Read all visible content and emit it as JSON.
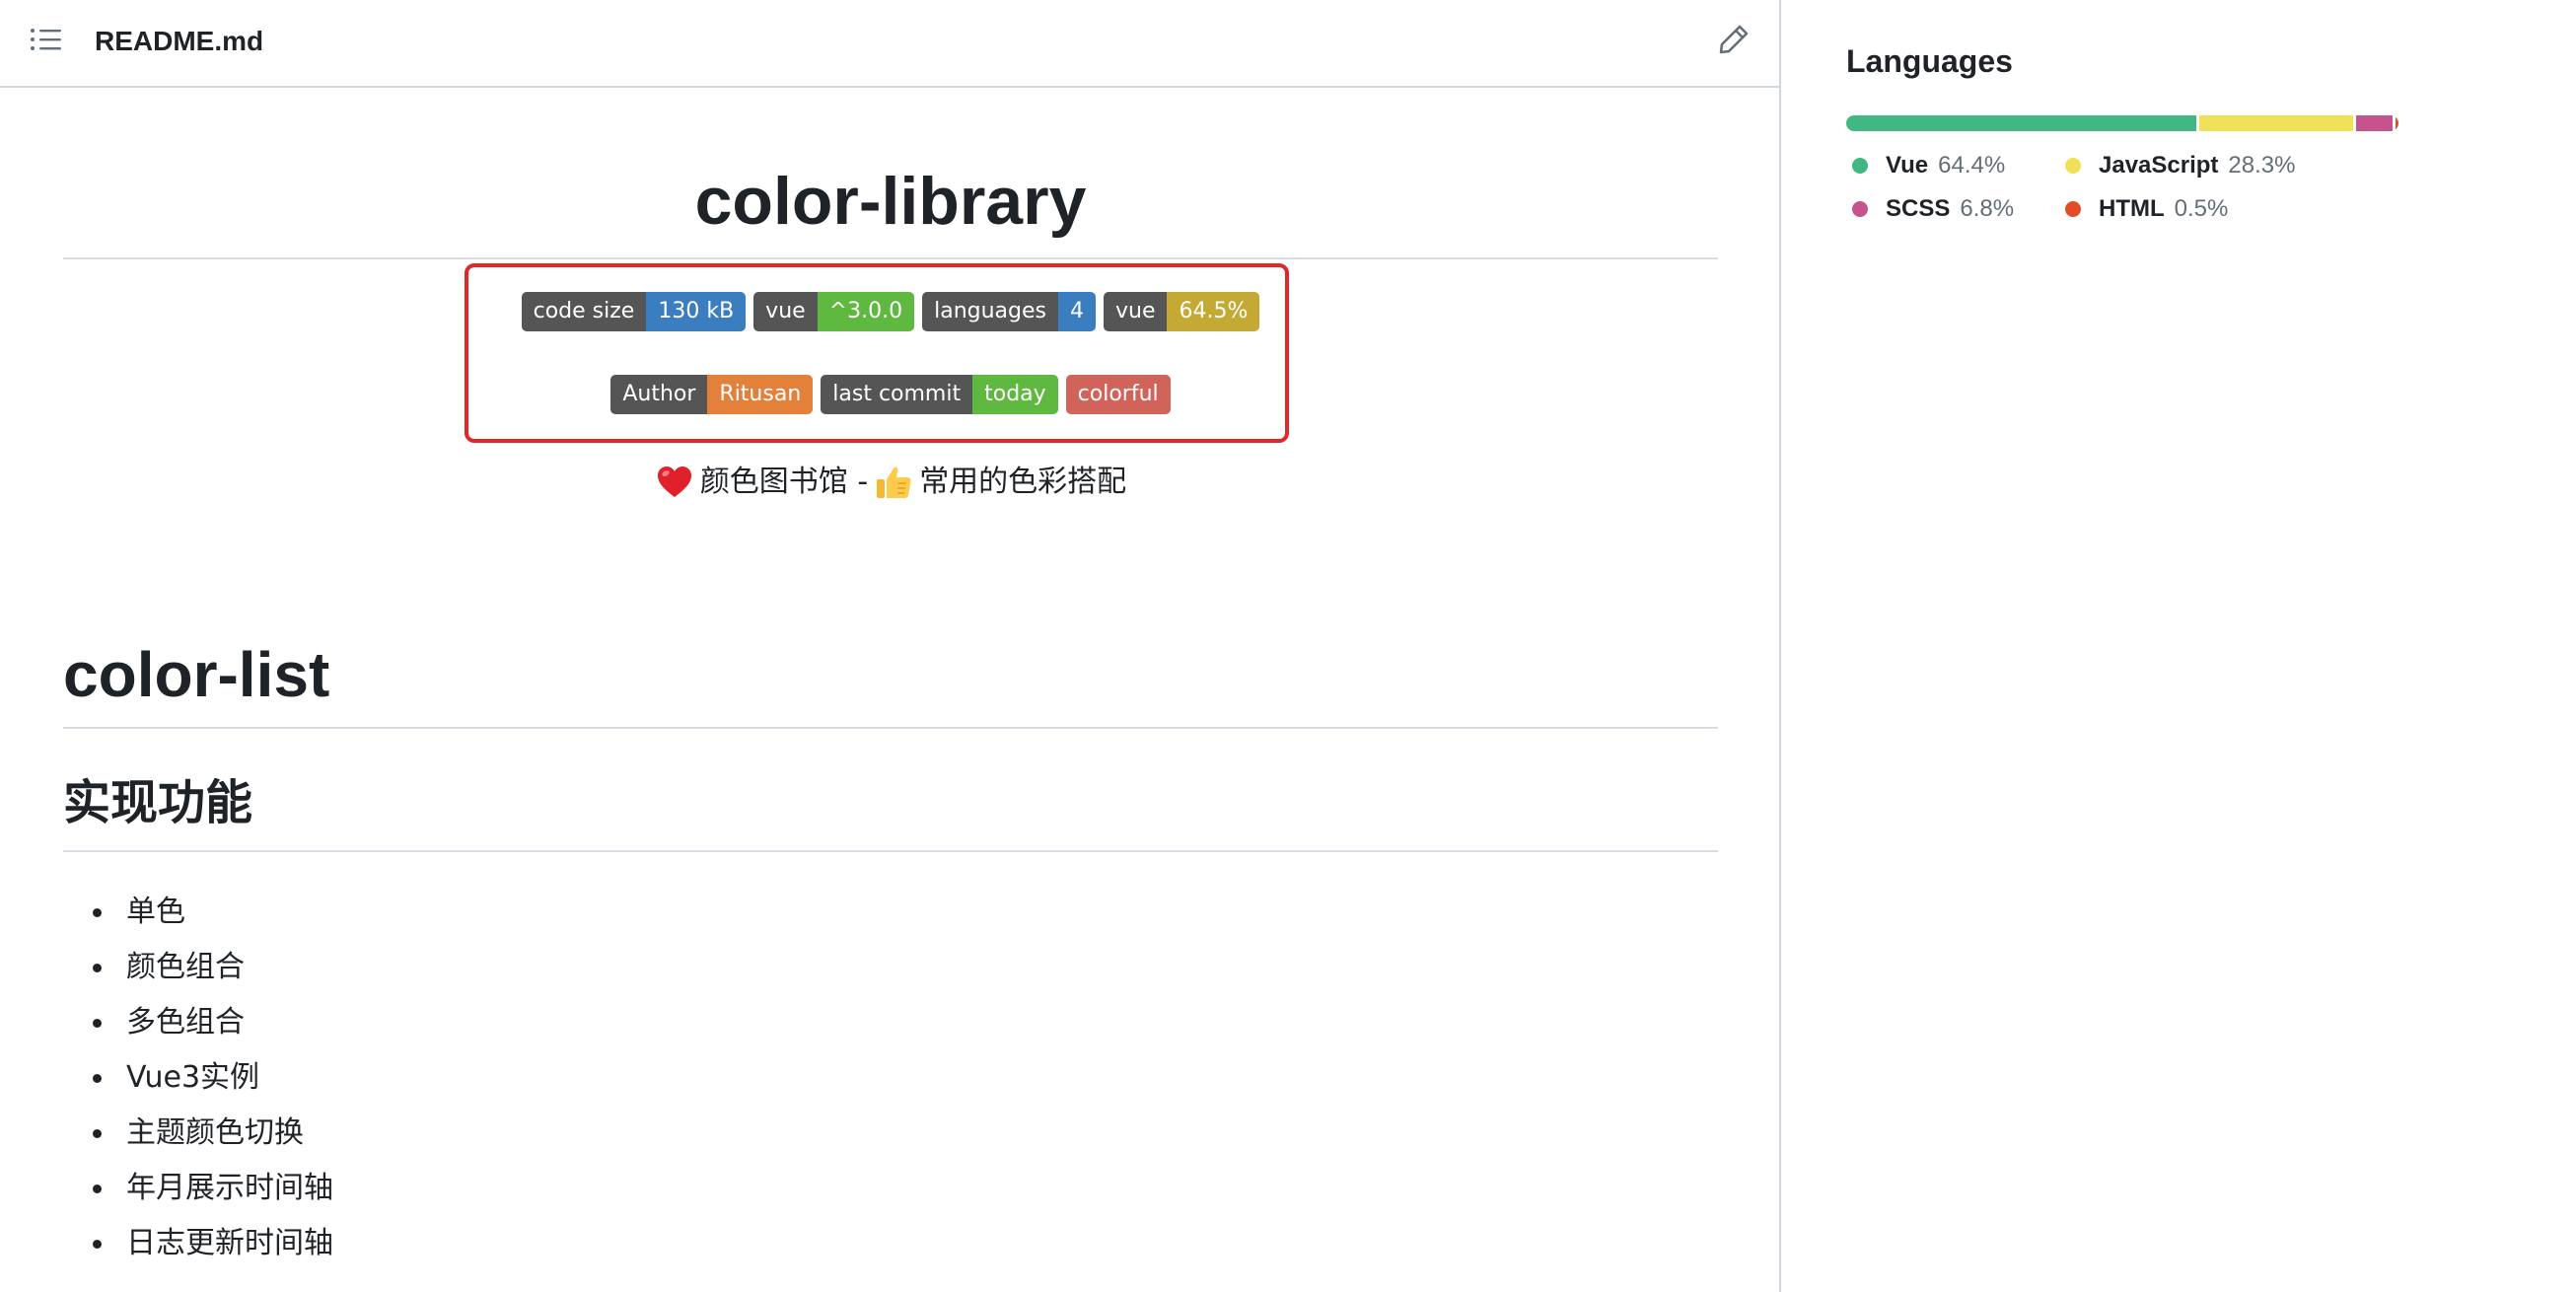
{
  "readme": {
    "filename": "README.md",
    "title": "color-library",
    "badges_row1": [
      {
        "label": "code size",
        "value": "130 kB",
        "color": "#3b7ebf"
      },
      {
        "label": "vue",
        "value": "^3.0.0",
        "color": "#5fb83f"
      },
      {
        "label": "languages",
        "value": "4",
        "color": "#3b7ebf"
      },
      {
        "label": "vue",
        "value": "64.5%",
        "color": "#c4a934"
      }
    ],
    "badges_row2": [
      {
        "label": "Author",
        "value": "Ritusan",
        "color": "#e3803a"
      },
      {
        "label": "last commit",
        "value": "today",
        "color": "#5fb83f"
      },
      {
        "label": "",
        "value": "colorful",
        "color": "#d0635a"
      }
    ],
    "tagline": {
      "part1": "颜色图书馆 -",
      "part2": "常用的色彩搭配",
      "emoji1": "heart-emoji-icon",
      "emoji2": "thumbs-up-emoji-icon"
    },
    "h1": "color-list",
    "h2": "实现功能",
    "features": [
      "单色",
      "颜色组合",
      "多色组合",
      "Vue3实例",
      "主题颜色切换",
      "年月展示时间轴",
      "日志更新时间轴"
    ],
    "icons": {
      "toc": "list-unordered-icon",
      "edit": "pencil-icon"
    },
    "highlight_color": "#e0282a"
  },
  "languages": {
    "title": "Languages",
    "items": [
      {
        "name": "Vue",
        "percent": "64.4%",
        "value": 64.4,
        "color": "#41b883"
      },
      {
        "name": "JavaScript",
        "percent": "28.3%",
        "value": 28.3,
        "color": "#f1e05a"
      },
      {
        "name": "SCSS",
        "percent": "6.8%",
        "value": 6.8,
        "color": "#c6538c"
      },
      {
        "name": "HTML",
        "percent": "0.5%",
        "value": 0.5,
        "color": "#e34c26"
      }
    ]
  }
}
